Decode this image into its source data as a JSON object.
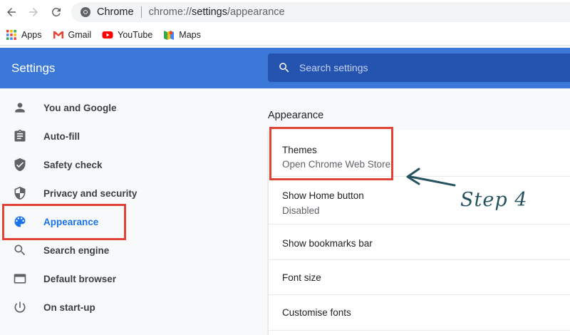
{
  "browser": {
    "site_name": "Chrome",
    "url": {
      "scheme": "chrome://",
      "host": "settings",
      "path": "/appearance"
    }
  },
  "bookmarks": [
    {
      "label": "Apps",
      "icon": "apps-grid-icon"
    },
    {
      "label": "Gmail",
      "icon": "gmail-icon"
    },
    {
      "label": "YouTube",
      "icon": "youtube-icon"
    },
    {
      "label": "Maps",
      "icon": "maps-icon"
    }
  ],
  "header": {
    "title": "Settings",
    "search_placeholder": "Search settings"
  },
  "sidebar": {
    "items": [
      {
        "label": "You and Google",
        "icon": "person-icon"
      },
      {
        "label": "Auto-fill",
        "icon": "clipboard-icon"
      },
      {
        "label": "Safety check",
        "icon": "shield-check-icon"
      },
      {
        "label": "Privacy and security",
        "icon": "shield-half-icon"
      },
      {
        "label": "Appearance",
        "icon": "palette-icon",
        "active": true
      },
      {
        "label": "Search engine",
        "icon": "search-icon"
      },
      {
        "label": "Default browser",
        "icon": "browser-window-icon"
      },
      {
        "label": "On start-up",
        "icon": "power-icon"
      }
    ]
  },
  "main": {
    "section_title": "Appearance",
    "rows": [
      {
        "title": "Themes",
        "subtitle": "Open Chrome Web Store"
      },
      {
        "title": "Show Home button",
        "subtitle": "Disabled"
      },
      {
        "title": "Show bookmarks bar"
      },
      {
        "title": "Font size"
      },
      {
        "title": "Customise fonts"
      }
    ]
  },
  "annotation": {
    "text": "Step 4",
    "color": "#25535f",
    "highlight_color": "#e04436"
  },
  "colors": {
    "header_blue": "#3c78d8",
    "search_blue": "#2553b0",
    "active_blue": "#1a73e8"
  }
}
